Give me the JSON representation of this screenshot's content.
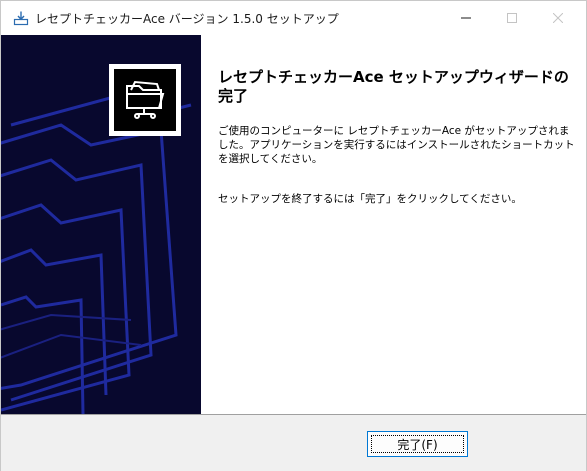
{
  "window": {
    "title": "レセプトチェッカーAce バージョン 1.5.0 セットアップ",
    "icon": "installer-icon",
    "controls": {
      "minimize_icon": "minimize-icon",
      "maximize_icon": "maximize-icon",
      "close_icon": "close-icon"
    }
  },
  "banner": {
    "background_color": "#08082e",
    "art_color": "#1f2a9e",
    "logo_icon": "folder-network-icon"
  },
  "main": {
    "heading": "レセプトチェッカーAce セットアップウィザードの完了",
    "paragraph1": "ご使用のコンピューターに レセプトチェッカーAce がセットアップされました。アプリケーションを実行するにはインストールされたショートカットを選択してください。",
    "paragraph2": "セットアップを終了するには「完了」をクリックしてください。"
  },
  "footer": {
    "finish_label": "完了(F)"
  },
  "colors": {
    "accent": "#0078d4",
    "footer_bg": "#f0f0f0"
  }
}
